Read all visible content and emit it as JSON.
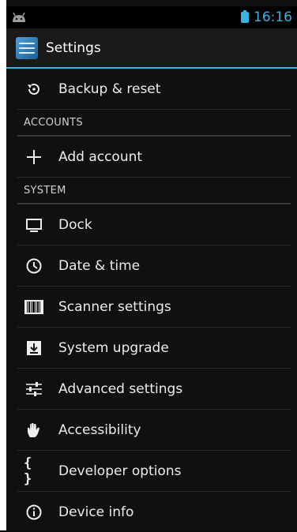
{
  "status": {
    "time": "16:16"
  },
  "appbar": {
    "title": "Settings"
  },
  "items": {
    "backup": "Backup & reset",
    "accounts_header": "ACCOUNTS",
    "add_account": "Add account",
    "system_header": "SYSTEM",
    "dock": "Dock",
    "date_time": "Date & time",
    "scanner": "Scanner settings",
    "upgrade": "System upgrade",
    "advanced": "Advanced settings",
    "accessibility": "Accessibility",
    "developer": "Developer options",
    "device_info": "Device info"
  },
  "colors": {
    "accent": "#33b5e5",
    "background": "#101010"
  },
  "icons": [
    "backup-icon",
    "add-icon",
    "dock-icon",
    "clock-icon",
    "barcode-icon",
    "download-icon",
    "sliders-icon",
    "hand-icon",
    "braces-icon",
    "info-icon"
  ]
}
